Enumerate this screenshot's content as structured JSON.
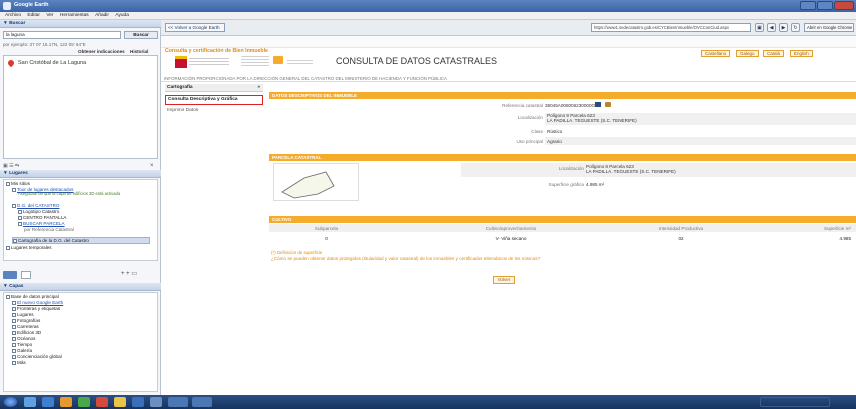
{
  "window": {
    "title": "Google Earth"
  },
  "menu": [
    "Archivo",
    "Editar",
    "Ver",
    "Herramientas",
    "Añadir",
    "Ayuda"
  ],
  "search": {
    "header": "▼ Buscar",
    "query": "la laguna",
    "button": "Buscar",
    "example": "por ejemplo: 37 07 16.17N, 122 05' 64\"E",
    "directions": "Obtener indicaciones",
    "history": "Historial",
    "result": "San Cristóbal de La Laguna"
  },
  "places": {
    "header": "▼ Lugares",
    "items": [
      "Mis sitios",
      "Tour de lugares destacados",
      "Asegúrate de que la capa de edificios 3D está activada",
      "D.G. del CATASTRO",
      "Logotipo Catastro",
      "CENTRO PANTALLA",
      "BUSCAR PARCELA",
      "por Referencia Catastral",
      "Cartografía de la D.G. del Catastro",
      "Lugares temporales"
    ]
  },
  "layers": {
    "header": "▼ Capas",
    "items": [
      "Base de datos principal",
      "El nuevo Google Earth",
      "Fronteras y etiquetas",
      "Lugares",
      "Fotografías",
      "Carreteras",
      "Edificios 3D",
      "Océanos",
      "Tiempo",
      "Galería",
      "Concienciación global",
      "Más"
    ]
  },
  "browser": {
    "back": "<< Volver a Google Earth",
    "url": "https://www1.sedecatastro.gob.es/CYCBienInmueble/OVCConCiud.aspx",
    "open": "Abrir en Google Chrome"
  },
  "page": {
    "heading": "Consulta y certificación de Bien Inmueble",
    "top_buttons": [
      "Castellano",
      "Galego",
      "Català",
      "English"
    ],
    "title": "CONSULTA DE DATOS CATASTRALES",
    "source": "INFORMACIÓN PROPORCIONADA POR LA DIRECCIÓN GENERAL DEL CATASTRO DEL MINISTERIO DE HACIENDA Y FUNCIÓN PÚBLICA",
    "nav": [
      "Cartografía",
      "Consulta Descriptiva y Gráfica",
      "Imprimir Datos"
    ],
    "nav_arrow": "»",
    "sections": {
      "datos": "DATOS DESCRIPTIVOS DEL INMUEBLE",
      "parcela": "PARCELA CATASTRAL",
      "cultivo": "CULTIVO"
    },
    "fields": [
      {
        "label": "Referencia catastral",
        "value": "38046A008006230000OZ"
      },
      {
        "label": "Localización",
        "value": "Polígono 8 Parcela 623\nLA PADILLA. TEGUESTE (S.C. TENERIFE)"
      },
      {
        "label": "Clase",
        "value": "Rústico"
      },
      {
        "label": "Uso principal",
        "value": "Agrario"
      }
    ],
    "parcela": [
      {
        "label": "Localización",
        "value": "Polígono 8 Parcela 623\nLA PADILLA. TEGUESTE (S.C. TENERIFE)"
      },
      {
        "label": "Superficie gráfica",
        "value": "4.985 m²"
      }
    ],
    "cultivo": {
      "headers": [
        "Subparcela",
        "Cultivo/aprovechamiento",
        "Intensidad Productiva",
        "Superficie m²"
      ],
      "row": [
        "0",
        "V- Viña secano",
        "02",
        "4.985"
      ]
    },
    "note": "(*) Definición de superficie",
    "help": "¿Cómo se pueden obtener datos protegidos (titularidad y valor catastral) de los inmuebles y certificados telemáticos de los mismos?",
    "volver": "Volver"
  },
  "colors": {
    "accent": "#f5ac2c",
    "highlight": "#e02020",
    "link": "#1d4fb0"
  }
}
